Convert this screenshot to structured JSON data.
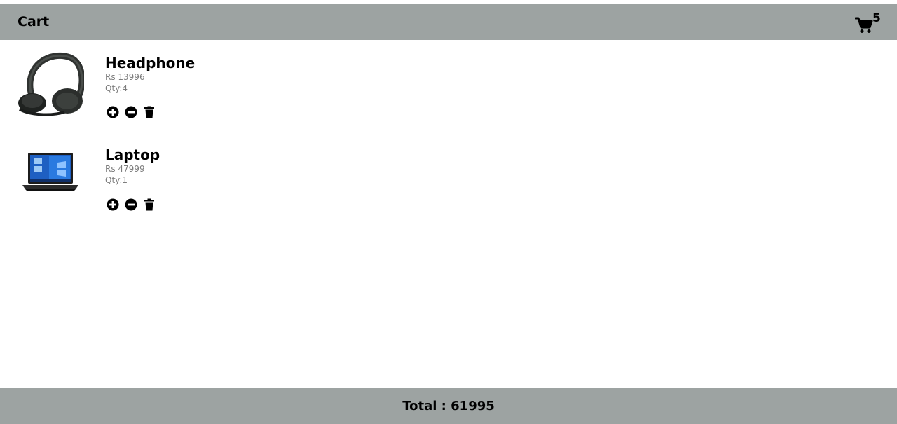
{
  "header": {
    "title": "Cart",
    "cart_icon": "cart-icon",
    "cart_count": "5"
  },
  "items": [
    {
      "name": "Headphone",
      "price": "Rs 13996",
      "qty": "Qty:4",
      "image": "headphone-image",
      "actions": [
        "plus-circle-icon",
        "minus-circle-icon",
        "trash-icon"
      ]
    },
    {
      "name": "Laptop",
      "price": "Rs 47999",
      "qty": "Qty:1",
      "image": "laptop-image",
      "actions": [
        "plus-circle-icon",
        "minus-circle-icon",
        "trash-icon"
      ]
    }
  ],
  "footer": {
    "total": "Total : 61995"
  },
  "colors": {
    "bar_background": "#9da3a2",
    "secondary_text": "#7d7d7d"
  }
}
